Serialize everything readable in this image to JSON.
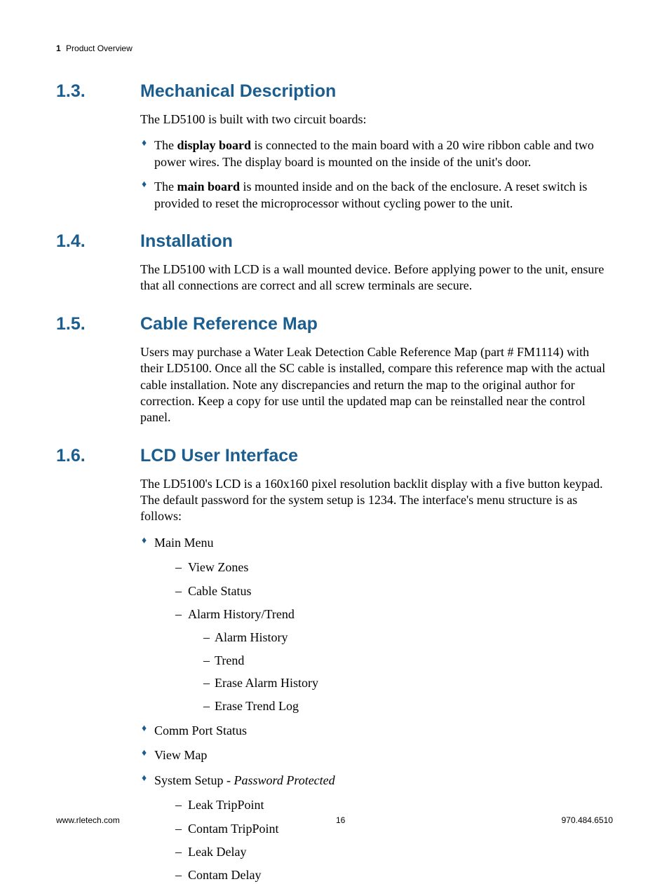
{
  "header": {
    "chapter_num": "1",
    "chapter_title": "Product Overview"
  },
  "sections": {
    "s13": {
      "num": "1.3.",
      "title": "Mechanical Description",
      "intro": "The LD5100 is built with two circuit boards:",
      "bullets": {
        "b1_pre": "The ",
        "b1_bold": "display board",
        "b1_post": " is connected to the main board with a 20 wire ribbon cable and two power wires. The display board is mounted on the inside of the unit's door.",
        "b2_pre": "The ",
        "b2_bold": "main board",
        "b2_post": " is mounted inside and on the back of the enclosure. A reset switch is provided to reset the microprocessor without cycling power to the unit."
      }
    },
    "s14": {
      "num": "1.4.",
      "title": "Installation",
      "para": "The LD5100 with LCD is a wall mounted device. Before applying power to the unit, ensure that all connections are correct and all screw terminals are secure."
    },
    "s15": {
      "num": "1.5.",
      "title": "Cable Reference Map",
      "para": "Users may purchase a Water Leak Detection Cable Reference Map (part # FM1114) with their LD5100. Once all the SC cable is installed, compare this reference map with the actual cable installation. Note any discrepancies and return the map to the original author for correction. Keep a copy for use until the updated map can be reinstalled near the control panel."
    },
    "s16": {
      "num": "1.6.",
      "title": "LCD User Interface",
      "para": "The LD5100's LCD is a 160x160 pixel resolution backlit display with a five button keypad. The default password for the system setup is 1234. The interface's menu structure is as follows:",
      "menu": {
        "main": "Main Menu",
        "view_zones": "View Zones",
        "cable_status": "Cable Status",
        "alarm_history_trend": "Alarm History/Trend",
        "alarm_history": "Alarm History",
        "trend": "Trend",
        "erase_alarm_history": "Erase Alarm History",
        "erase_trend_log": "Erase Trend Log",
        "comm_port_status": "Comm Port Status",
        "view_map": "View Map",
        "system_setup_pre": "System Setup - ",
        "system_setup_italic": "Password Protected",
        "leak_trippoint": "Leak TripPoint",
        "contam_trippoint": "Contam TripPoint",
        "leak_delay": "Leak Delay",
        "contam_delay": "Contam Delay"
      }
    }
  },
  "footer": {
    "left": "www.rletech.com",
    "center": "16",
    "right": "970.484.6510"
  }
}
